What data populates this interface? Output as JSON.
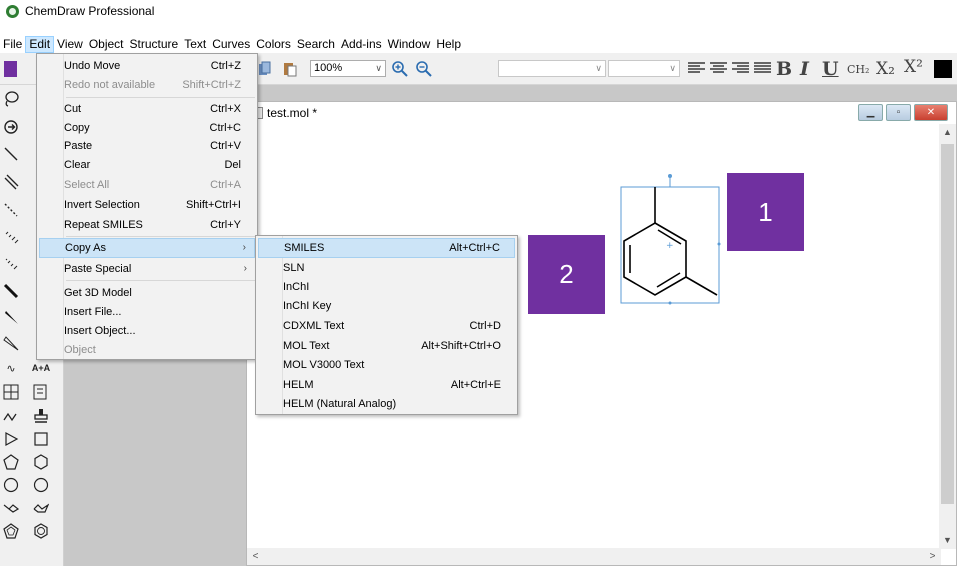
{
  "app": {
    "title": "ChemDraw Professional"
  },
  "menubar": [
    "File",
    "Edit",
    "View",
    "Object",
    "Structure",
    "Text",
    "Curves",
    "Colors",
    "Search",
    "Add-ins",
    "Window",
    "Help"
  ],
  "toolbar": {
    "zoom": "100%"
  },
  "format_buttons": {
    "bold": "B",
    "italic": "I",
    "underline": "U",
    "ch2": "CH₂",
    "subscript": "X₂",
    "superscript": "X²"
  },
  "document": {
    "title": "test.mol *"
  },
  "callouts": {
    "one": "1",
    "two": "2"
  },
  "edit_menu": {
    "items": [
      {
        "label": "Undo Move",
        "shortcut": "Ctrl+Z",
        "disabled": false
      },
      {
        "label": "Redo not available",
        "shortcut": "Shift+Ctrl+Z",
        "disabled": true
      },
      {
        "label": "Cut",
        "shortcut": "Ctrl+X",
        "disabled": false
      },
      {
        "label": "Copy",
        "shortcut": "Ctrl+C",
        "disabled": false
      },
      {
        "label": "Paste",
        "shortcut": "Ctrl+V",
        "disabled": false
      },
      {
        "label": "Clear",
        "shortcut": "Del",
        "disabled": false
      },
      {
        "label": "Select All",
        "shortcut": "Ctrl+A",
        "disabled": true
      },
      {
        "label": "Invert Selection",
        "shortcut": "Shift+Ctrl+I",
        "disabled": false
      },
      {
        "label": "Repeat SMILES",
        "shortcut": "Ctrl+Y",
        "disabled": false
      },
      {
        "label": "Copy As",
        "shortcut": "",
        "disabled": false
      },
      {
        "label": "Paste Special",
        "shortcut": "",
        "disabled": false
      },
      {
        "label": "Get 3D Model",
        "shortcut": "",
        "disabled": false
      },
      {
        "label": "Insert File...",
        "shortcut": "",
        "disabled": false
      },
      {
        "label": "Insert Object...",
        "shortcut": "",
        "disabled": false
      },
      {
        "label": "Object",
        "shortcut": "",
        "disabled": true
      }
    ]
  },
  "copy_as_menu": {
    "items": [
      {
        "label": "SMILES",
        "shortcut": "Alt+Ctrl+C"
      },
      {
        "label": "SLN",
        "shortcut": ""
      },
      {
        "label": "InChI",
        "shortcut": ""
      },
      {
        "label": "InChI Key",
        "shortcut": ""
      },
      {
        "label": "CDXML Text",
        "shortcut": "Ctrl+D"
      },
      {
        "label": "MOL Text",
        "shortcut": "Alt+Shift+Ctrl+O"
      },
      {
        "label": "MOL V3000 Text",
        "shortcut": ""
      },
      {
        "label": "HELM",
        "shortcut": "Alt+Ctrl+E"
      },
      {
        "label": "HELM (Natural Analog)",
        "shortcut": ""
      }
    ]
  },
  "colors": {
    "callout": "#7030a0",
    "menu_highlight": "#cce4f7"
  }
}
